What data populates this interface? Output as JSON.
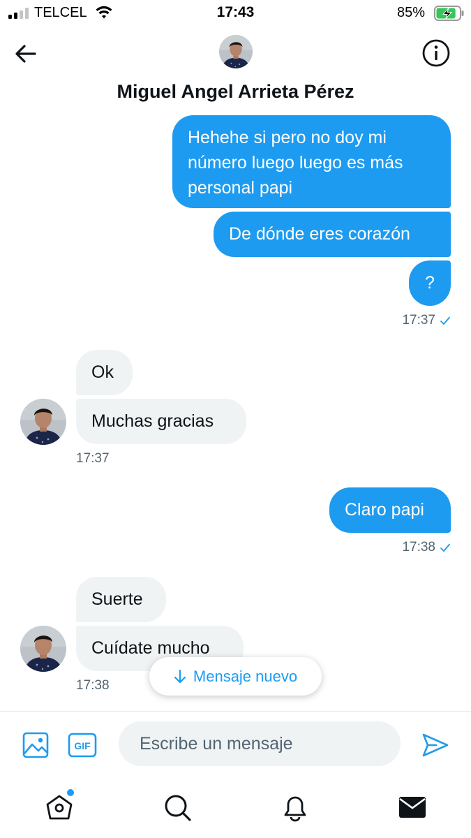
{
  "status_bar": {
    "carrier": "TELCEL",
    "time": "17:43",
    "battery_percent": "85%",
    "battery_level": 0.85,
    "icons": [
      "signal-icon",
      "wifi-icon",
      "battery-charging-icon"
    ]
  },
  "header": {
    "contact_name": "Miguel Angel Arrieta Pérez",
    "icons": [
      "back-arrow-icon",
      "info-icon"
    ]
  },
  "messages": {
    "group1": {
      "m1": [
        "Hehehe si pero no doy mi",
        "número luego luego es más",
        "personal papi"
      ],
      "m2": "De dónde eres corazón",
      "m3": "?",
      "time": "17:37"
    },
    "group2": {
      "m1": "Ok",
      "m2": "Muchas gracias",
      "time": "17:37"
    },
    "group3": {
      "m1": "Claro papi",
      "time": "17:38"
    },
    "group4": {
      "m1": "Suerte",
      "m2": "Cuídate mucho",
      "time": "17:38"
    }
  },
  "new_message_pill": {
    "label": "Mensaje nuevo"
  },
  "composer": {
    "placeholder": "Escribe un mensaje",
    "gif_label": "GIF",
    "icons": [
      "image-icon",
      "gif-icon",
      "send-icon"
    ]
  },
  "tabbar": {
    "icons": [
      "home-icon",
      "search-icon",
      "notifications-bell-icon",
      "messages-mail-icon"
    ]
  },
  "colors": {
    "accent": "#1d9bf0",
    "incoming_bubble": "#eff3f4",
    "secondary_text": "#536471",
    "battery_green": "#34c759"
  }
}
